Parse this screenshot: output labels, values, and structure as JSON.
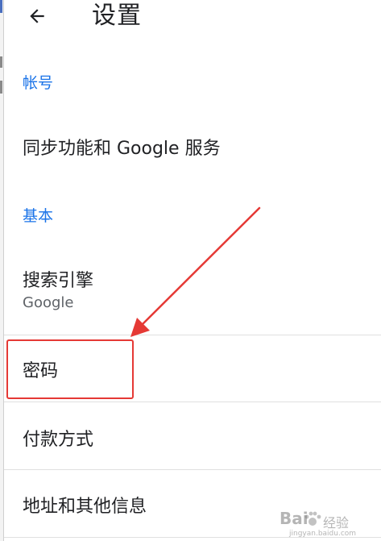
{
  "toolbar": {
    "title": "设置",
    "back_icon": "arrow-left-icon"
  },
  "sections": {
    "account": {
      "header": "帐号",
      "items": [
        {
          "title": "同步功能和 Google 服务"
        }
      ]
    },
    "basic": {
      "header": "基本",
      "items": [
        {
          "title": "搜索引擎",
          "subtitle": "Google"
        },
        {
          "title": "密码"
        },
        {
          "title": "付款方式"
        },
        {
          "title": "地址和其他信息"
        }
      ]
    }
  },
  "watermark": {
    "main": "Bai",
    "suffix": "经验",
    "url": "jingyan.baidu.com"
  },
  "colors": {
    "accent": "#1a73e8",
    "annotation": "#e53935",
    "text": "#202124",
    "secondary_text": "#5f6368",
    "divider": "#e0e0e0"
  }
}
